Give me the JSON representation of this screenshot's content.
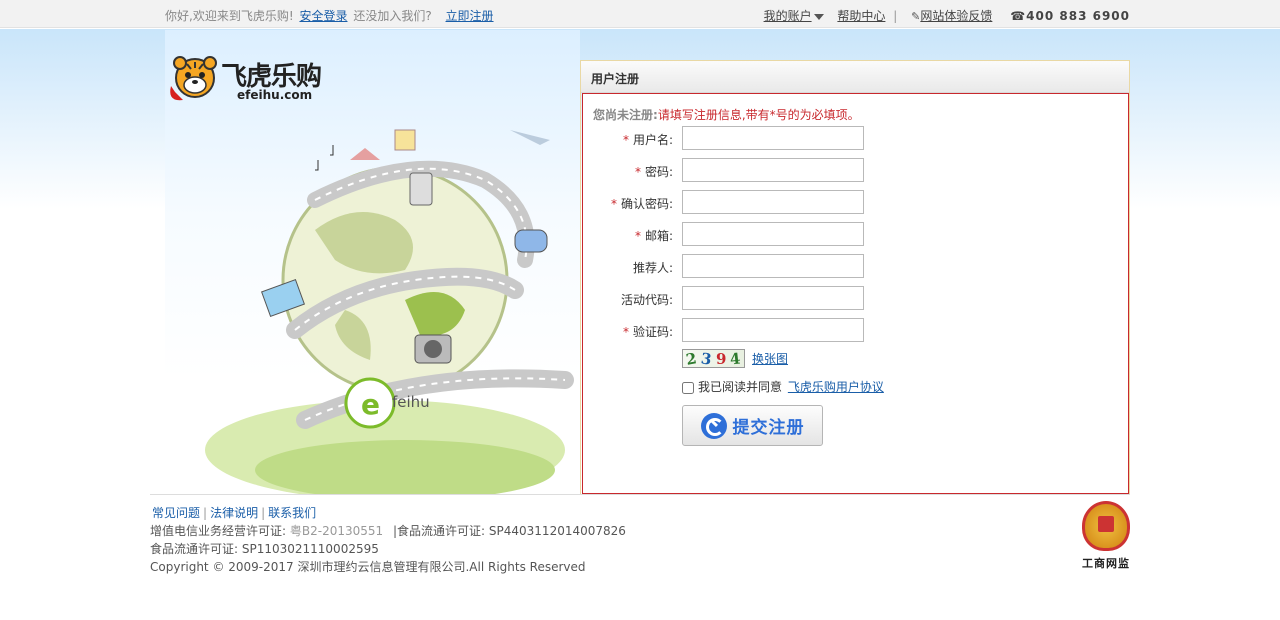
{
  "topbar": {
    "greeting": "你好,欢迎来到飞虎乐购!",
    "login": "安全登录",
    "not_joined": "还没加入我们?",
    "register": "立即注册",
    "my_account": "我的账户",
    "help_center": "帮助中心",
    "divider": "|",
    "feedback": "网站体验反馈",
    "phone": "400 883 6900"
  },
  "logo": {
    "name": "飞虎乐购",
    "url": "efeihu.com"
  },
  "hero": {
    "badge_text": "feihu"
  },
  "panel": {
    "title": "用户注册",
    "notice_label": "您尚未注册:",
    "notice_message": "请填写注册信息,带有*号的为必填项。",
    "fields": [
      {
        "label": "用户名:",
        "required": "*",
        "value": ""
      },
      {
        "label": "密码:",
        "required": "*",
        "value": ""
      },
      {
        "label": "确认密码:",
        "required": "*",
        "value": ""
      },
      {
        "label": "邮箱:",
        "required": "*",
        "value": ""
      },
      {
        "label": "推荐人:",
        "required": "",
        "value": ""
      },
      {
        "label": "活动代码:",
        "required": "",
        "value": ""
      },
      {
        "label": "验证码:",
        "required": "*",
        "value": ""
      }
    ],
    "captcha": [
      "2",
      "3",
      "9",
      "4"
    ],
    "swap_image": "换张图",
    "agree_text": "我已阅读并同意",
    "agreement_link": "飞虎乐购用户协议",
    "submit": "提交注册"
  },
  "footer": {
    "links": [
      "常见问题",
      "法律说明",
      "联系我们"
    ],
    "license_label": "增值电信业务经营许可证:",
    "license_value": "粤B2-20130551",
    "food_label_1": "|食品流通许可证:",
    "food_value_1": "SP4403112014007826",
    "food_line_2": "食品流通许可证: SP1103021110002595",
    "copyright": "Copyright © 2009-2017 深圳市理约云信息管理有限公司.All Rights Reserved",
    "badge_caption": "工商网监"
  },
  "colors": {
    "accent": "#c8282d",
    "link": "#1a5ea8",
    "button_text": "#2e6fd8"
  }
}
